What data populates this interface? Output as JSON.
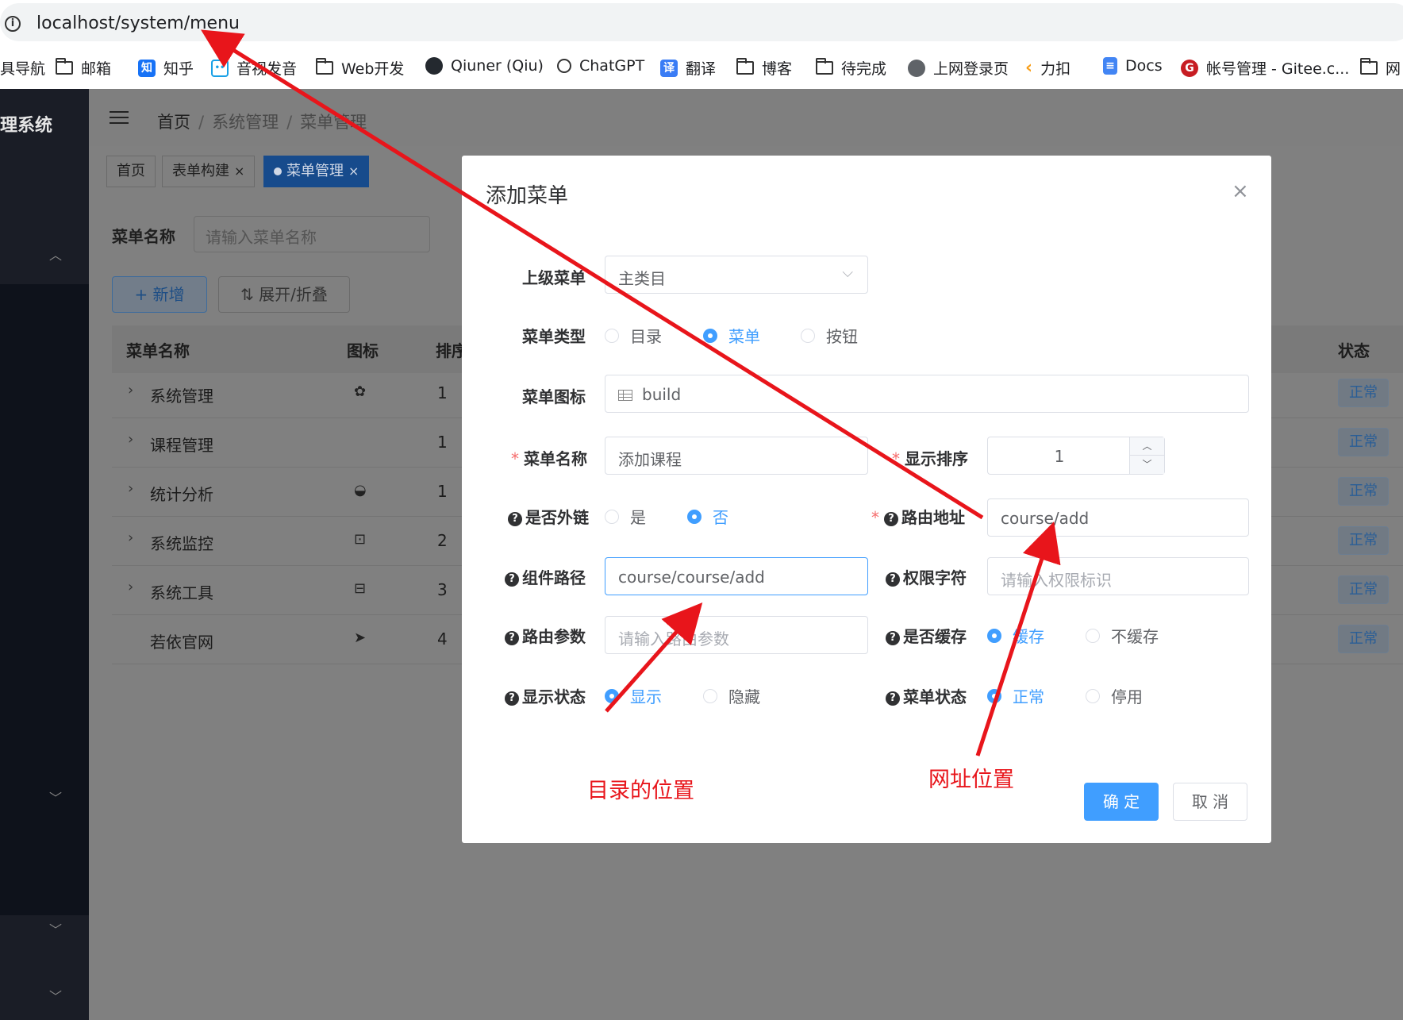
{
  "browser": {
    "url": "localhost/system/menu",
    "bookmarks": [
      {
        "label": "具导航",
        "icon": "none"
      },
      {
        "label": "邮箱",
        "icon": "folder-icon"
      },
      {
        "label": "知乎",
        "icon": "zhihu-icon"
      },
      {
        "label": "音视发音",
        "icon": "bilibili-icon"
      },
      {
        "label": "Web开发",
        "icon": "folder-icon"
      },
      {
        "label": "Qiuner (Qiu)",
        "icon": "github-icon"
      },
      {
        "label": "ChatGPT",
        "icon": "openai-icon"
      },
      {
        "label": "翻译",
        "icon": "translate-icon"
      },
      {
        "label": "博客",
        "icon": "folder-icon"
      },
      {
        "label": "待完成",
        "icon": "folder-icon"
      },
      {
        "label": "上网登录页",
        "icon": "globe-icon"
      },
      {
        "label": "力扣",
        "icon": "leetcode-icon"
      },
      {
        "label": "Docs",
        "icon": "docs-icon"
      },
      {
        "label": "帐号管理 - Gitee.c...",
        "icon": "gitee-icon"
      },
      {
        "label": "网",
        "icon": "folder-icon"
      }
    ]
  },
  "sidebar": {
    "brand": "理系统"
  },
  "navbar": {
    "breadcrumb": [
      "首页",
      "系统管理",
      "菜单管理"
    ],
    "separator": "/"
  },
  "tags": [
    {
      "label": "首页"
    },
    {
      "label": "表单构建",
      "close": "×"
    },
    {
      "label": "菜单管理",
      "close": "×",
      "active": true
    }
  ],
  "search": {
    "label": "菜单名称",
    "placeholder": "请输入菜单名称",
    "add_label": "+ 新增",
    "expand_label": "⇅ 展开/折叠"
  },
  "table": {
    "headers": [
      "菜单名称",
      "图标",
      "排序",
      "状态"
    ],
    "rows": [
      {
        "caret": "›",
        "name": "系统管理",
        "icon": "gear-icon",
        "order": "1",
        "status": "正常"
      },
      {
        "caret": "›",
        "name": "课程管理",
        "icon": "",
        "order": "1",
        "status": "正常"
      },
      {
        "caret": "›",
        "name": "统计分析",
        "icon": "dashboard-icon",
        "order": "1",
        "status": "正常"
      },
      {
        "caret": "›",
        "name": "系统监控",
        "icon": "monitor-icon",
        "order": "2",
        "status": "正常"
      },
      {
        "caret": "›",
        "name": "系统工具",
        "icon": "toolbox-icon",
        "order": "3",
        "status": "正常"
      },
      {
        "caret": "",
        "name": "若依官网",
        "icon": "send-icon",
        "order": "4",
        "status": "正常"
      }
    ]
  },
  "dialog": {
    "title": "添加菜单",
    "close": "×",
    "parent_label": "上级菜单",
    "parent_value": "主类目",
    "type_label": "菜单类型",
    "type_options": [
      "目录",
      "菜单",
      "按钮"
    ],
    "type_selected": "菜单",
    "icon_label": "菜单图标",
    "icon_value": "build",
    "name_label": "菜单名称",
    "name_value": "添加课程",
    "order_label": "显示排序",
    "order_value": "1",
    "external_label": "是否外链",
    "external_options": [
      "是",
      "否"
    ],
    "external_selected": "否",
    "route_label": "路由地址",
    "route_value": "course/add",
    "component_label": "组件路径",
    "component_value": "course/course/add",
    "perm_label": "权限字符",
    "perm_placeholder": "请输入权限标识",
    "query_label": "路由参数",
    "query_placeholder": "请输入路由参数",
    "cache_label": "是否缓存",
    "cache_options": [
      "缓存",
      "不缓存"
    ],
    "cache_selected": "缓存",
    "visible_label": "显示状态",
    "visible_options": [
      "显示",
      "隐藏"
    ],
    "visible_selected": "显示",
    "status_label": "菜单状态",
    "status_options": [
      "正常",
      "停用"
    ],
    "status_selected": "正常",
    "ok_label": "确 定",
    "cancel_label": "取 消"
  },
  "annotations": {
    "dir_position": "目录的位置",
    "url_position": "网址位置",
    "color": "#e8151b"
  },
  "colors": {
    "primary": "#409eff",
    "sidebar": "#1a1d26",
    "overlay": "#808080",
    "required": "#f56c6c"
  }
}
